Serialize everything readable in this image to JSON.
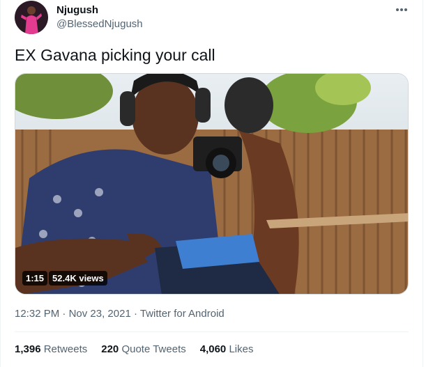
{
  "author": {
    "name": "Njugush",
    "handle": "@BlessedNjugush"
  },
  "tweet": {
    "text": "EX Gavana picking your call"
  },
  "media": {
    "duration": "1:15",
    "views": "52.4K views"
  },
  "meta": {
    "time": "12:32 PM",
    "separator1": " · ",
    "date": "Nov 23, 2021",
    "separator2": " · ",
    "source": "Twitter for Android"
  },
  "stats": {
    "retweets_count": "1,396",
    "retweets_label": "Retweets",
    "quote_count": "220",
    "quote_label": "Quote Tweets",
    "likes_count": "4,060",
    "likes_label": "Likes"
  },
  "icons": {
    "more": "more-horizontal-icon"
  }
}
